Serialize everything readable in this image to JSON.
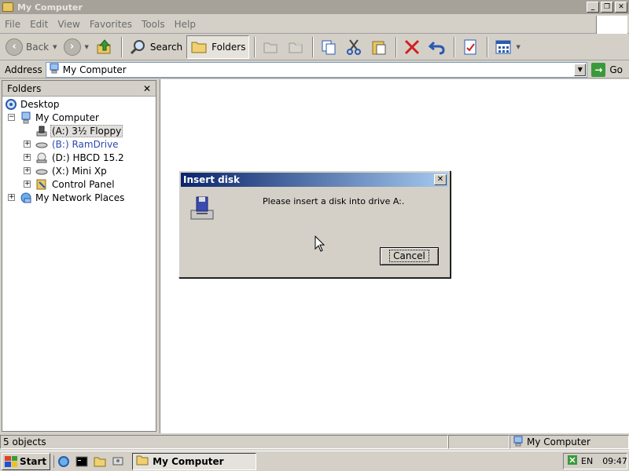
{
  "window": {
    "title": "My Computer"
  },
  "menu": [
    "File",
    "Edit",
    "View",
    "Favorites",
    "Tools",
    "Help"
  ],
  "toolbar": {
    "back": "Back",
    "search": "Search",
    "folders": "Folders"
  },
  "address": {
    "label": "Address",
    "value": "My Computer",
    "go": "Go"
  },
  "folders_pane": {
    "title": "Folders",
    "items": [
      {
        "label": "Desktop"
      },
      {
        "label": "My Computer",
        "expander": "−"
      },
      {
        "label": "(A:) 3½ Floppy"
      },
      {
        "label": "(B:) RamDrive",
        "expander": "+"
      },
      {
        "label": "(D:) HBCD 15.2",
        "expander": "+"
      },
      {
        "label": "(X:) Mini Xp",
        "expander": "+"
      },
      {
        "label": "Control Panel",
        "expander": "+"
      },
      {
        "label": "My Network Places",
        "expander": "+"
      }
    ]
  },
  "dialog": {
    "title": "Insert disk",
    "message": "Please insert a disk into drive A:.",
    "cancel": "Cancel"
  },
  "status": {
    "objects": "5 objects",
    "location": "My Computer"
  },
  "taskbar": {
    "start": "Start",
    "task": "My Computer",
    "lang": "EN",
    "time": "09:47"
  },
  "colors": {
    "dialog_title_start": "#0a246a",
    "dialog_title_end": "#a6caf0",
    "inactive_title": "#a6a29a",
    "go_green": "#3a9a3a"
  }
}
